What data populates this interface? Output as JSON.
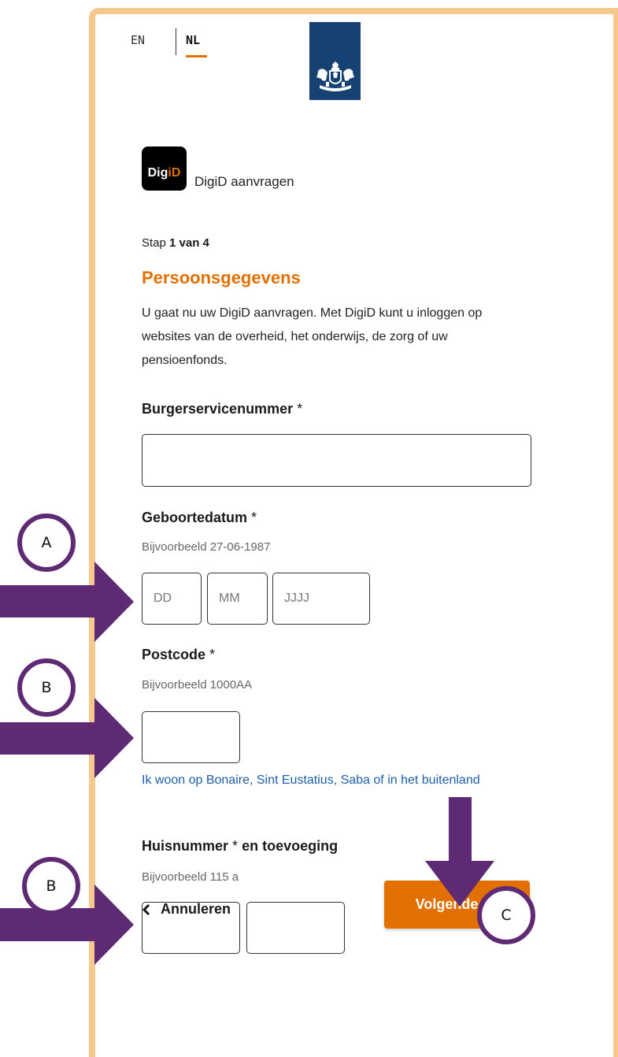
{
  "language": {
    "en": "EN",
    "nl": "NL",
    "active": "NL"
  },
  "app": {
    "logo_text_main": "Dig",
    "logo_text_accent": "iD",
    "title": "DigiD aanvragen"
  },
  "step": {
    "prefix": "Stap",
    "current": "1 van 4"
  },
  "section": {
    "title": "Persoonsgegevens",
    "intro": "U gaat nu uw DigiD aanvragen. Met DigiD kunt u inloggen op websites van de overheid, het onderwijs, de zorg of uw pensioenfonds."
  },
  "fields": {
    "bsn": {
      "label": "Burgerservicenummer",
      "required_mark": "*",
      "value": ""
    },
    "birthdate": {
      "label": "Geboortedatum",
      "required_mark": "*",
      "hint": "Bijvoorbeeld 27-06-1987",
      "day_placeholder": "DD",
      "month_placeholder": "MM",
      "year_placeholder": "JJJJ"
    },
    "postcode": {
      "label": "Postcode",
      "required_mark": "*",
      "hint": "Bijvoorbeeld 1000AA",
      "value": ""
    },
    "abroad_link": "Ik woon op Bonaire, Sint Eustatius, Saba of in het buitenland",
    "housenumber": {
      "label": "Huisnummer",
      "required_mark": "*",
      "label_suffix": "en toevoeging",
      "hint": "Bijvoorbeeld 115 a",
      "number_value": "",
      "addition_value": ""
    }
  },
  "actions": {
    "cancel": "Annuleren",
    "next": "Volgende"
  },
  "annotations": {
    "a": "A",
    "b1": "B",
    "b2": "B",
    "c": "C"
  },
  "colors": {
    "accent": "#e17000",
    "frame": "#f5c88e",
    "marker": "#5e2a73",
    "logo_bg": "#154273",
    "link": "#1f5ea8"
  }
}
